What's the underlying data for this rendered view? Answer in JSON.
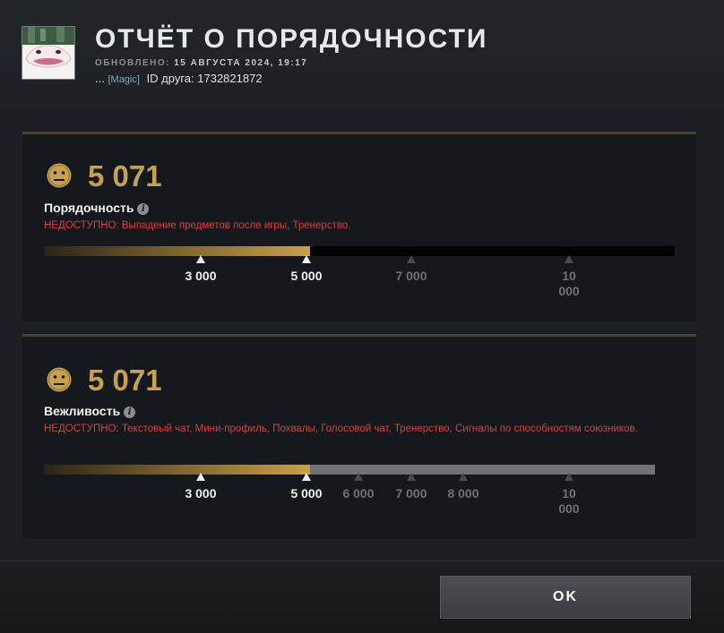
{
  "header": {
    "title": "ОТЧЁТ О ПОРЯДОЧНОСТИ",
    "updated_label": "ОБНОВЛЕНО:",
    "updated_date": "15 АВГУСТА 2024, 19:17",
    "player_name": "...",
    "guild_tag": "[Magic]",
    "friend_id": "ID друга: 1732821872"
  },
  "sections": [
    {
      "score": "5 071",
      "label": "Порядочность",
      "unavailable_prefix": "НЕДОСТУПНО:",
      "unavailable_text": "Выпадение предметов после игры, Тренерство.",
      "progress_fraction": 0.42,
      "ticks": [
        {
          "label": "3 000",
          "active": true
        },
        {
          "label": "5 000",
          "active": true
        },
        {
          "label": "7 000",
          "active": false
        },
        {
          "label": "10 000",
          "active": false
        }
      ]
    },
    {
      "score": "5 071",
      "label": "Вежливость",
      "unavailable_prefix": "НЕДОСТУПНО:",
      "unavailable_text": "Текстовый чат, Мини-профиль, Похвалы, Голосовой чат, Тренерство, Сигналы по способностям союзников.",
      "progress_fraction": 0.44,
      "ticks": [
        {
          "label": "3 000",
          "active": true
        },
        {
          "label": "5 000",
          "active": true
        },
        {
          "label": "6 000",
          "active": false
        },
        {
          "label": "7 000",
          "active": false
        },
        {
          "label": "8 000",
          "active": false
        },
        {
          "label": "10 000",
          "active": false
        }
      ]
    }
  ],
  "footer": {
    "ok_label": "OK"
  },
  "colors": {
    "accent_gold": "#c7a14f",
    "unavailable_red": "#d84040",
    "panel_bg": "#15181c"
  },
  "icons": {
    "avatar": "creature-avatar",
    "score_face": "neutral-face-icon",
    "info": "info-icon"
  }
}
